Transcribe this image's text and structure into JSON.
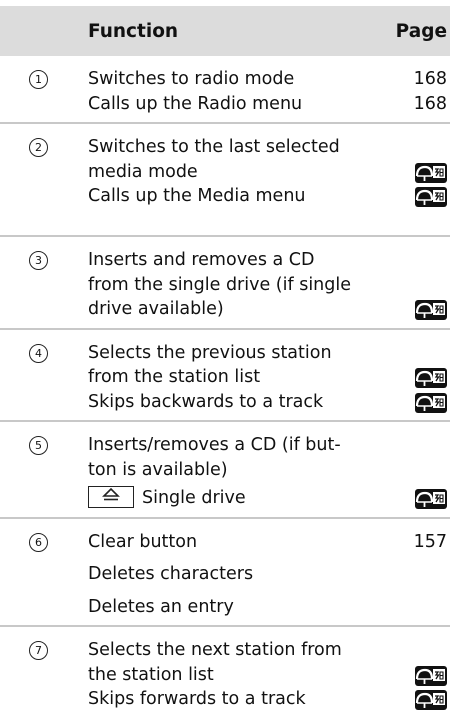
{
  "header": {
    "col_function": "Function",
    "col_page": "Page"
  },
  "rows": [
    {
      "number": "1",
      "lines": [
        "Switches to radio mode",
        "Calls up the Radio menu"
      ],
      "pages": [
        "168",
        "168"
      ]
    },
    {
      "number": "2",
      "lines": [
        "Switches to the last selected",
        "media mode",
        "Calls up the Media menu"
      ],
      "pages": [
        "",
        "nav-icon",
        "nav-icon"
      ]
    },
    {
      "number": "3",
      "lines": [
        "Inserts and removes a CD",
        "from the single drive (if single",
        "drive available)"
      ],
      "pages": [
        "",
        "",
        "nav-icon"
      ]
    },
    {
      "number": "4",
      "lines": [
        "Selects the previous station",
        "from the station list",
        "Skips backwards to a track"
      ],
      "pages": [
        "",
        "nav-icon",
        "nav-icon"
      ]
    },
    {
      "number": "5",
      "lines": [
        "Inserts/removes a CD (if but-",
        "ton is available)"
      ],
      "key": {
        "glyph": "≙",
        "label": "Single drive"
      },
      "pages": [
        "",
        "",
        "nav-icon"
      ]
    },
    {
      "number": "6",
      "lines": [
        "Clear button",
        "Deletes characters",
        "Deletes an entry"
      ],
      "pages": [
        "157",
        "",
        ""
      ]
    },
    {
      "number": "7",
      "lines": [
        "Selects the next station from",
        "the station list",
        "Skips forwards to a track"
      ],
      "pages": [
        "",
        "nav-icon",
        "nav-icon"
      ]
    }
  ]
}
